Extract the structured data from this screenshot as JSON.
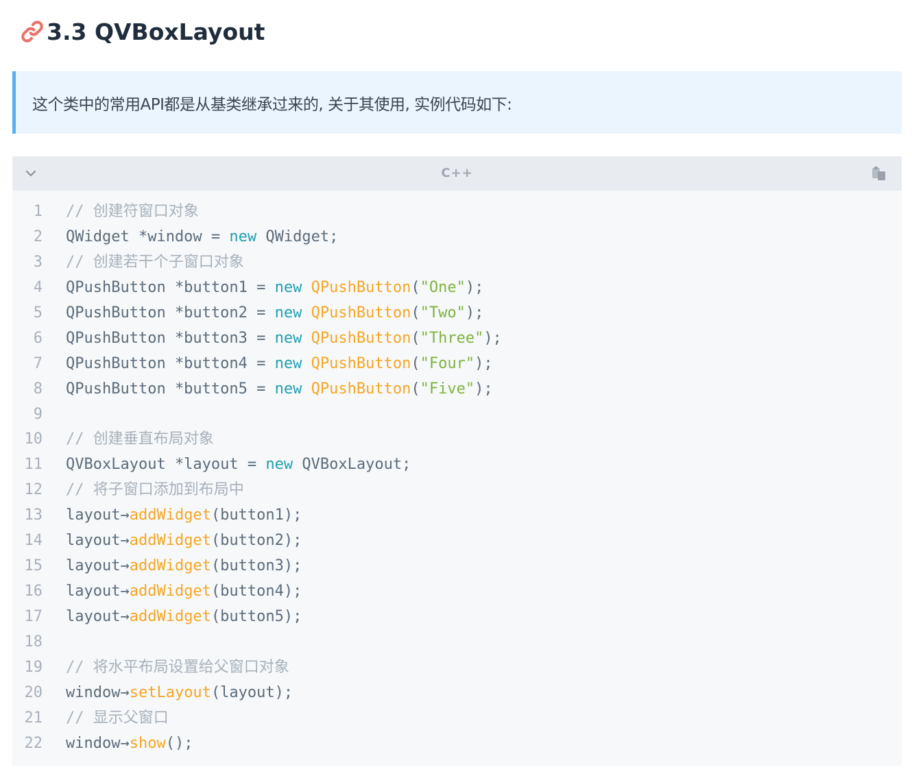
{
  "heading": {
    "icon": "link-icon",
    "text": "3.3 QVBoxLayout"
  },
  "note": {
    "text": "这个类中的常用API都是从基类继承过来的, 关于其使用, 实例代码如下:"
  },
  "code_block": {
    "language": "C++",
    "collapse_icon": "chevron-down-icon",
    "copy_icon": "copy-icon",
    "colors": {
      "comment": "#a8b1ba",
      "plain": "#5c6b7a",
      "keyword": "#1e9fb0",
      "type": "#f5a623",
      "function": "#f5a623",
      "string": "#7fb33b"
    },
    "lines": [
      {
        "n": "1",
        "tokens": [
          {
            "t": "comment",
            "v": "// 创建符窗口对象"
          }
        ]
      },
      {
        "n": "2",
        "tokens": [
          {
            "t": "plain",
            "v": "QWidget *window = "
          },
          {
            "t": "kw",
            "v": "new"
          },
          {
            "t": "plain",
            "v": " QWidget;"
          }
        ]
      },
      {
        "n": "3",
        "tokens": [
          {
            "t": "comment",
            "v": "// 创建若干个子窗口对象"
          }
        ]
      },
      {
        "n": "4",
        "tokens": [
          {
            "t": "plain",
            "v": "QPushButton *button1 = "
          },
          {
            "t": "kw",
            "v": "new"
          },
          {
            "t": "plain",
            "v": " "
          },
          {
            "t": "type",
            "v": "QPushButton"
          },
          {
            "t": "punct",
            "v": "("
          },
          {
            "t": "str",
            "v": "\"One\""
          },
          {
            "t": "punct",
            "v": ");"
          }
        ]
      },
      {
        "n": "5",
        "tokens": [
          {
            "t": "plain",
            "v": "QPushButton *button2 = "
          },
          {
            "t": "kw",
            "v": "new"
          },
          {
            "t": "plain",
            "v": " "
          },
          {
            "t": "type",
            "v": "QPushButton"
          },
          {
            "t": "punct",
            "v": "("
          },
          {
            "t": "str",
            "v": "\"Two\""
          },
          {
            "t": "punct",
            "v": ");"
          }
        ]
      },
      {
        "n": "6",
        "tokens": [
          {
            "t": "plain",
            "v": "QPushButton *button3 = "
          },
          {
            "t": "kw",
            "v": "new"
          },
          {
            "t": "plain",
            "v": " "
          },
          {
            "t": "type",
            "v": "QPushButton"
          },
          {
            "t": "punct",
            "v": "("
          },
          {
            "t": "str",
            "v": "\"Three\""
          },
          {
            "t": "punct",
            "v": ");"
          }
        ]
      },
      {
        "n": "7",
        "tokens": [
          {
            "t": "plain",
            "v": "QPushButton *button4 = "
          },
          {
            "t": "kw",
            "v": "new"
          },
          {
            "t": "plain",
            "v": " "
          },
          {
            "t": "type",
            "v": "QPushButton"
          },
          {
            "t": "punct",
            "v": "("
          },
          {
            "t": "str",
            "v": "\"Four\""
          },
          {
            "t": "punct",
            "v": ");"
          }
        ]
      },
      {
        "n": "8",
        "tokens": [
          {
            "t": "plain",
            "v": "QPushButton *button5 = "
          },
          {
            "t": "kw",
            "v": "new"
          },
          {
            "t": "plain",
            "v": " "
          },
          {
            "t": "type",
            "v": "QPushButton"
          },
          {
            "t": "punct",
            "v": "("
          },
          {
            "t": "str",
            "v": "\"Five\""
          },
          {
            "t": "punct",
            "v": ");"
          }
        ]
      },
      {
        "n": "9",
        "tokens": []
      },
      {
        "n": "10",
        "tokens": [
          {
            "t": "comment",
            "v": "// 创建垂直布局对象"
          }
        ]
      },
      {
        "n": "11",
        "tokens": [
          {
            "t": "plain",
            "v": "QVBoxLayout *layout = "
          },
          {
            "t": "kw",
            "v": "new"
          },
          {
            "t": "plain",
            "v": " QVBoxLayout;"
          }
        ]
      },
      {
        "n": "12",
        "tokens": [
          {
            "t": "comment",
            "v": "// 将子窗口添加到布局中"
          }
        ]
      },
      {
        "n": "13",
        "tokens": [
          {
            "t": "plain",
            "v": "layout→"
          },
          {
            "t": "fn",
            "v": "addWidget"
          },
          {
            "t": "punct",
            "v": "(button1);"
          }
        ]
      },
      {
        "n": "14",
        "tokens": [
          {
            "t": "plain",
            "v": "layout→"
          },
          {
            "t": "fn",
            "v": "addWidget"
          },
          {
            "t": "punct",
            "v": "(button2);"
          }
        ]
      },
      {
        "n": "15",
        "tokens": [
          {
            "t": "plain",
            "v": "layout→"
          },
          {
            "t": "fn",
            "v": "addWidget"
          },
          {
            "t": "punct",
            "v": "(button3);"
          }
        ]
      },
      {
        "n": "16",
        "tokens": [
          {
            "t": "plain",
            "v": "layout→"
          },
          {
            "t": "fn",
            "v": "addWidget"
          },
          {
            "t": "punct",
            "v": "(button4);"
          }
        ]
      },
      {
        "n": "17",
        "tokens": [
          {
            "t": "plain",
            "v": "layout→"
          },
          {
            "t": "fn",
            "v": "addWidget"
          },
          {
            "t": "punct",
            "v": "(button5);"
          }
        ]
      },
      {
        "n": "18",
        "tokens": []
      },
      {
        "n": "19",
        "tokens": [
          {
            "t": "comment",
            "v": "// 将水平布局设置给父窗口对象"
          }
        ]
      },
      {
        "n": "20",
        "tokens": [
          {
            "t": "plain",
            "v": "window→"
          },
          {
            "t": "fn",
            "v": "setLayout"
          },
          {
            "t": "punct",
            "v": "(layout);"
          }
        ]
      },
      {
        "n": "21",
        "tokens": [
          {
            "t": "comment",
            "v": "// 显示父窗口"
          }
        ]
      },
      {
        "n": "22",
        "tokens": [
          {
            "t": "plain",
            "v": "window→"
          },
          {
            "t": "fn",
            "v": "show"
          },
          {
            "t": "punct",
            "v": "();"
          }
        ]
      }
    ]
  }
}
